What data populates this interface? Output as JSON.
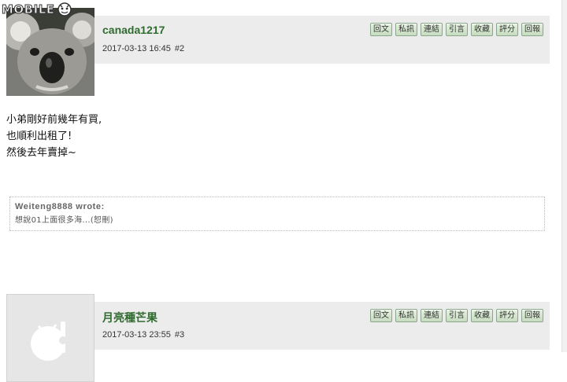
{
  "site": {
    "logo_text": "MOBILE"
  },
  "actions_labels": [
    "回文",
    "私訊",
    "連結",
    "引言",
    "收藏",
    "評分",
    "回報"
  ],
  "posts": [
    {
      "author": "canada1217",
      "date": "2017-03-13 16:45",
      "floor": "#2",
      "avatar": "koala-photo",
      "content_lines": [
        "小弟剛好前幾年有買,",
        "也順利出租了!",
        "然後去年賣掉~"
      ],
      "quote": {
        "author_line": "Weiteng8888 wrote:",
        "text": "想說01上面很多海...(恕刪)"
      }
    },
    {
      "author": "月亮種芒果",
      "date": "2017-03-13 23:55",
      "floor": "#3",
      "avatar": "default-avatar"
    }
  ]
}
